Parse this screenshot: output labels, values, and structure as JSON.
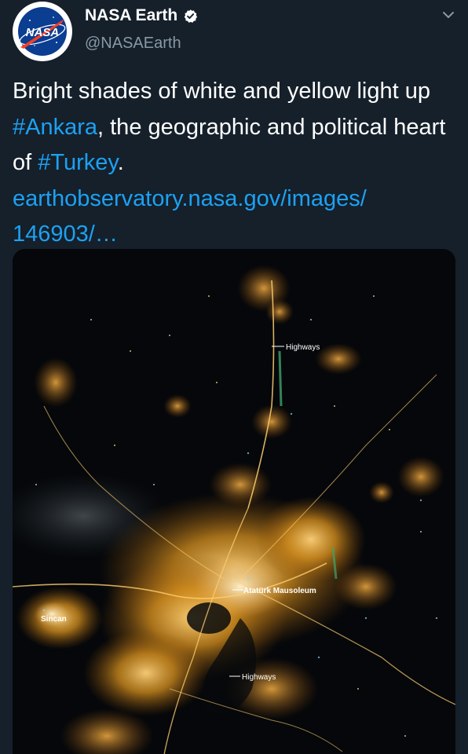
{
  "account": {
    "display_name": "NASA Earth",
    "handle": "@NASAEarth",
    "avatar_logo_text": "NASA",
    "verified": true
  },
  "tweet": {
    "text_1": "Bright shades of white and yellow light up ",
    "hashtag_1": "#Ankara",
    "text_2": ", the geographic and political heart of ",
    "hashtag_2": "#Turkey",
    "text_3": ".",
    "link": "earthobservatory.nasa.gov/images/ 146903/…"
  },
  "media": {
    "labels": {
      "highways_top": "Highways",
      "ataturk": "Atatürk Mausoleum",
      "sincan": "Sincan",
      "highways_bottom": "Highways"
    }
  },
  "icons": {
    "verified": "verified-badge-icon",
    "menu": "chevron-down-icon"
  },
  "colors": {
    "background": "#15202b",
    "link": "#1da1f2",
    "secondary_text": "#8899a6",
    "city_lights": "#e6a23c"
  }
}
